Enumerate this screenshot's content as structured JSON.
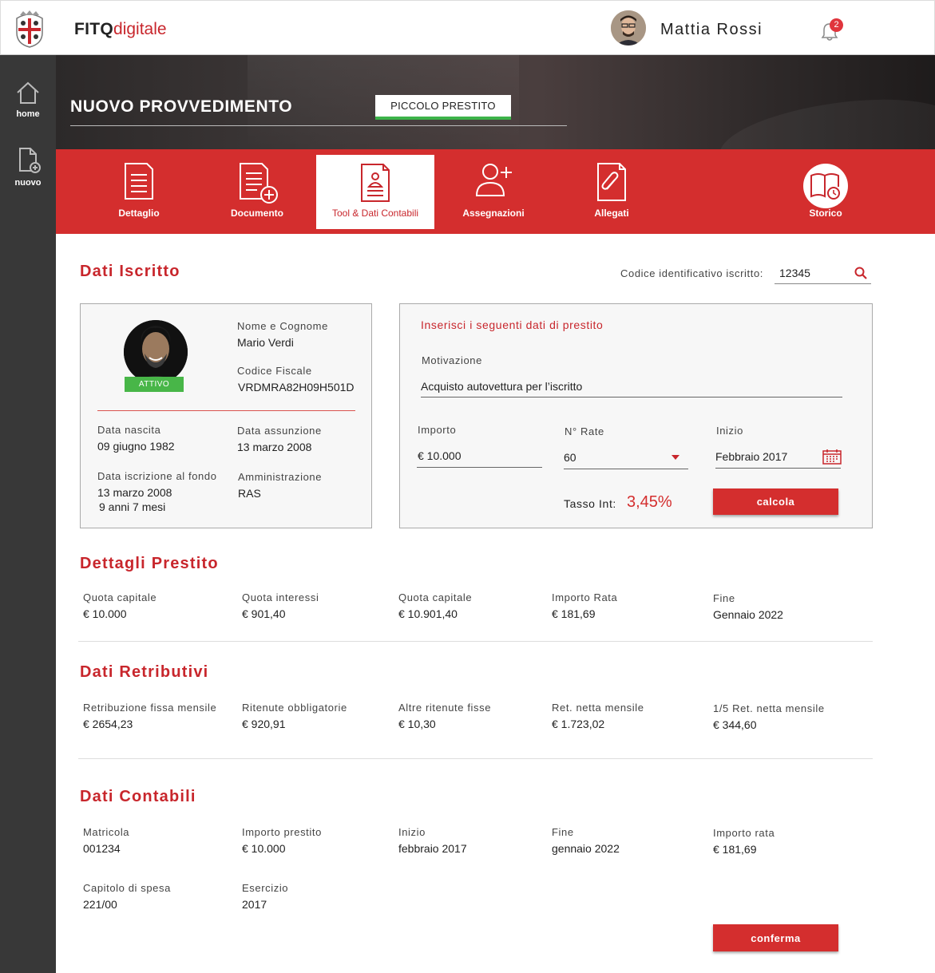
{
  "header": {
    "brand_bold": "FITQ",
    "brand_light": "digitale",
    "user_name": "Mattia Rossi",
    "notifications_count": "2"
  },
  "sidebar": {
    "items": [
      {
        "label": "home",
        "icon": "home-icon"
      },
      {
        "label": "nuovo",
        "icon": "new-document-icon"
      }
    ]
  },
  "hero": {
    "title": "NUOVO PROVVEDIMENTO",
    "tag": "PICCOLO PRESTITO"
  },
  "tabs": [
    {
      "label": "Dettaglio",
      "icon": "document-lines-icon"
    },
    {
      "label": "Documento",
      "icon": "document-add-icon"
    },
    {
      "label": "Tool & Dati Contabili",
      "icon": "accounting-tool-icon",
      "active": true
    },
    {
      "label": "Assegnazioni",
      "icon": "assign-user-icon"
    },
    {
      "label": "Allegati",
      "icon": "attachment-icon"
    },
    {
      "label": "Storico",
      "icon": "history-book-icon"
    }
  ],
  "dati_iscritto": {
    "title": "Dati Iscritto",
    "search_label": "Codice identificativo iscritto:",
    "search_value": "12345",
    "status": "ATTIVO",
    "nome_label": "Nome e Cognome",
    "nome_value": "Mario Verdi",
    "cf_label": "Codice Fiscale",
    "cf_value": "VRDMRA82H09H501D",
    "nascita_label": "Data nascita",
    "nascita_value": "09 giugno 1982",
    "assunzione_label": "Data assunzione",
    "assunzione_value": "13 marzo 2008",
    "iscrizione_label": "Data iscrizione al fondo",
    "iscrizione_value": "13 marzo 2008",
    "iscrizione_durata": "9 anni 7 mesi",
    "amministrazione_label": "Amministrazione",
    "amministrazione_value": "RAS"
  },
  "prestito_form": {
    "title": "Inserisci i seguenti dati di prestito",
    "motivazione_label": "Motivazione",
    "motivazione_value": "Acquisto autovettura per l’iscritto",
    "importo_label": "Importo",
    "importo_value": "€ 10.000",
    "rate_label": "N° Rate",
    "rate_value": "60",
    "inizio_label": "Inizio",
    "inizio_value": "Febbraio 2017",
    "tasso_label": "Tasso Int:",
    "tasso_value": "3,45%",
    "calcola_label": "calcola"
  },
  "dettagli_prestito": {
    "title": "Dettagli Prestito",
    "fields": [
      {
        "label": "Quota capitale",
        "value": "€ 10.000"
      },
      {
        "label": "Quota interessi",
        "value": "€ 901,40"
      },
      {
        "label": "Quota capitale",
        "value": "€ 10.901,40"
      },
      {
        "label": "Importo Rata",
        "value": "€ 181,69"
      },
      {
        "label": "Fine",
        "value": "Gennaio 2022"
      }
    ]
  },
  "dati_retributivi": {
    "title": "Dati Retributivi",
    "fields": [
      {
        "label": "Retribuzione fissa mensile",
        "value": "€ 2654,23"
      },
      {
        "label": "Ritenute obbligatorie",
        "value": "€ 920,91"
      },
      {
        "label": "Altre ritenute fisse",
        "value": "€ 10,30"
      },
      {
        "label": "Ret. netta mensile",
        "value": "€ 1.723,02"
      },
      {
        "label": "1/5  Ret. netta mensile",
        "value": "€ 344,60"
      }
    ]
  },
  "dati_contabili": {
    "title": "Dati Contabili",
    "fields": [
      {
        "label": "Matricola",
        "value": "001234"
      },
      {
        "label": "Importo prestito",
        "value": "€ 10.000"
      },
      {
        "label": "Inizio",
        "value": "febbraio 2017"
      },
      {
        "label": "Fine",
        "value": "gennaio 2022"
      },
      {
        "label": "Importo rata",
        "value": "€ 181,69"
      },
      {
        "label": "Capitolo di spesa",
        "value": "221/00"
      },
      {
        "label": "Esercizio",
        "value": "2017"
      }
    ],
    "conferma_label": "conferma"
  },
  "colors": {
    "accent_red": "#d42e2e",
    "sidebar_dark": "#383838",
    "status_green": "#48b648"
  }
}
